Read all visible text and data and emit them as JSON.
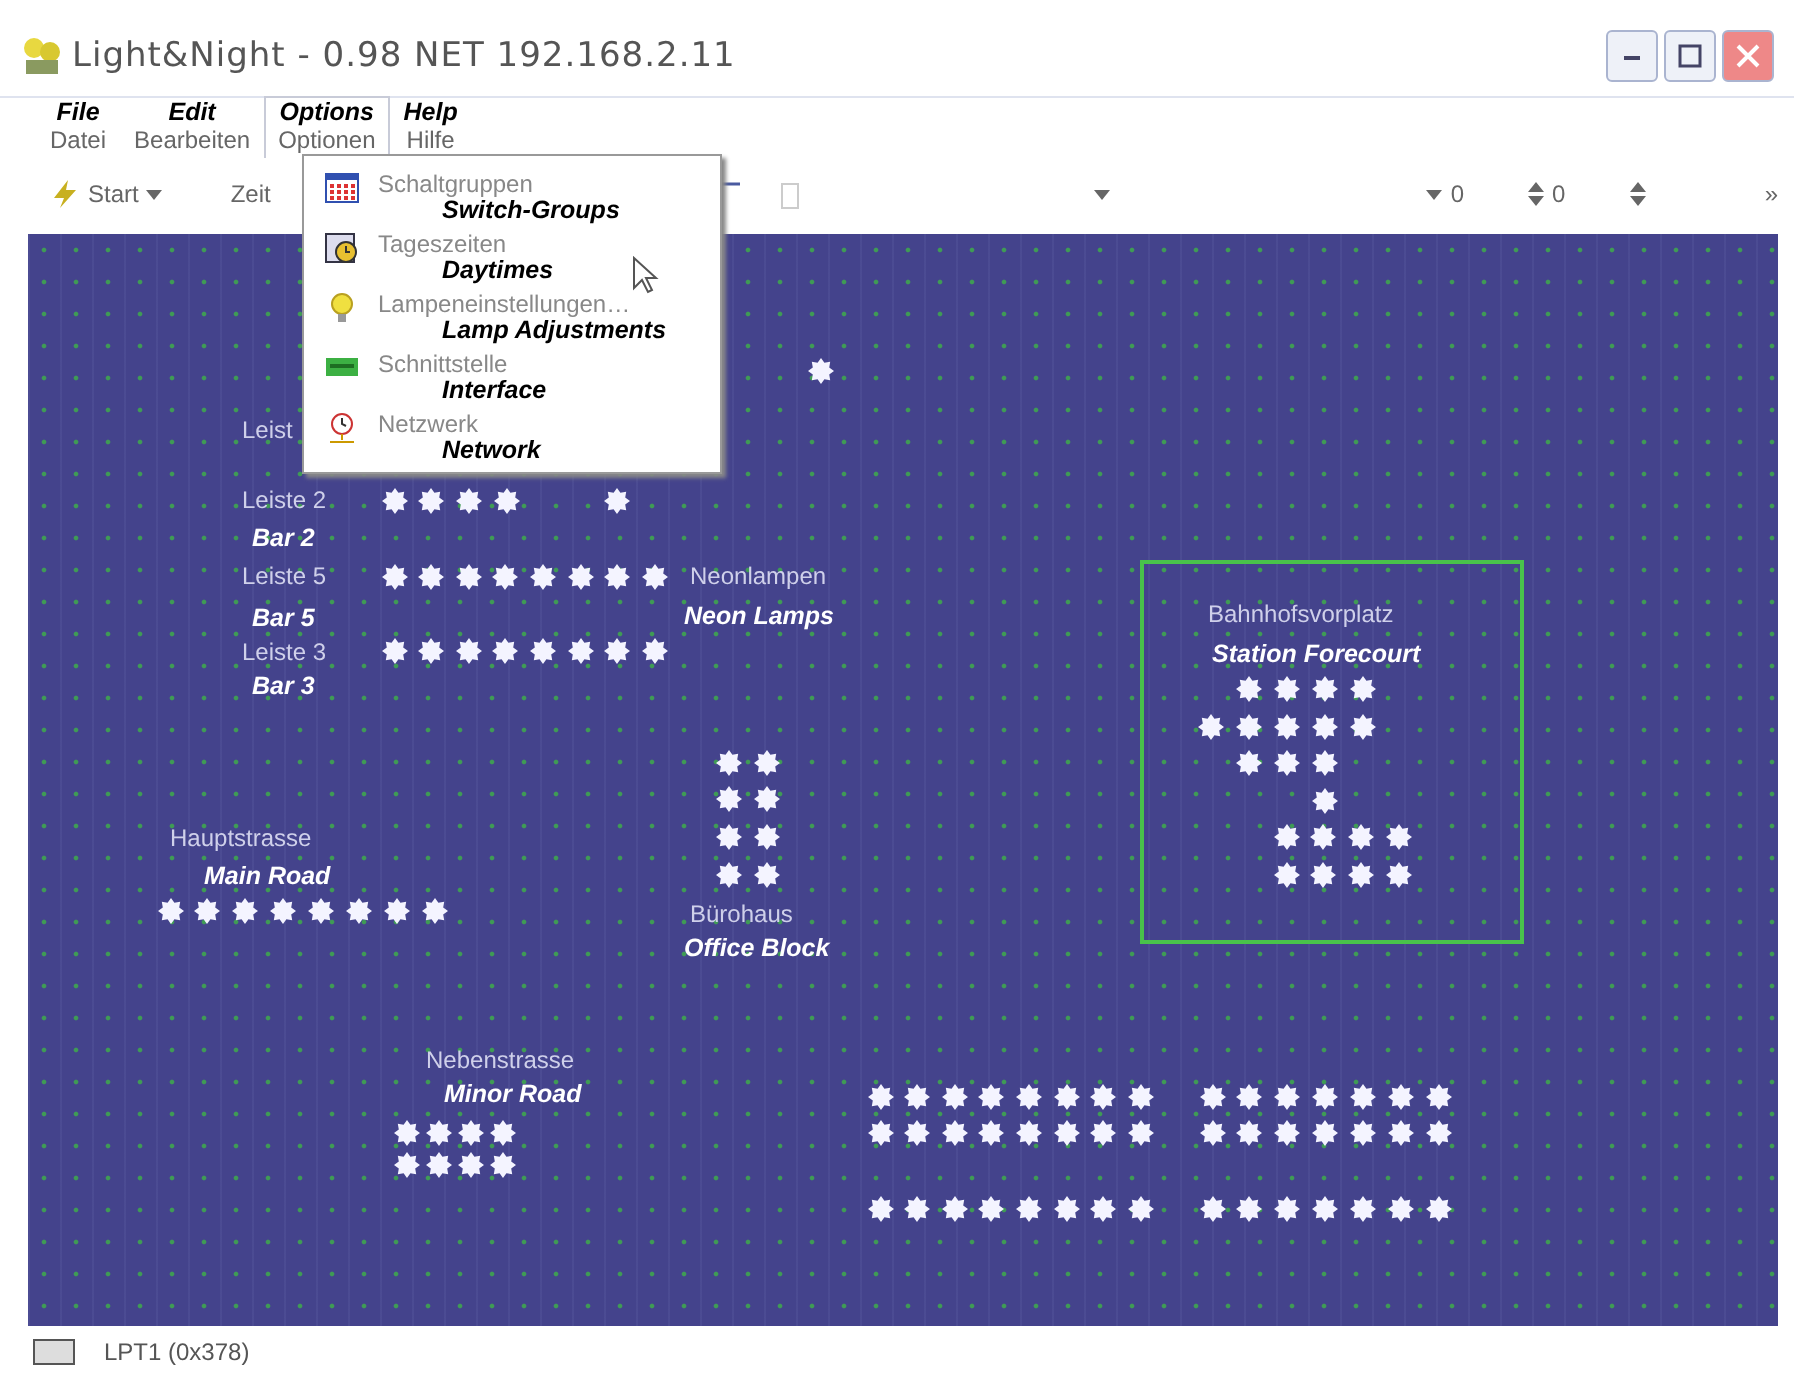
{
  "window": {
    "title": "Light&Night - 0.98 NET 192.168.2.11"
  },
  "menu_bar": [
    {
      "label": "Datei",
      "annotation": "File",
      "selected": false
    },
    {
      "label": "Bearbeiten",
      "annotation": "Edit",
      "selected": false
    },
    {
      "label": "Optionen",
      "annotation": "Options",
      "selected": true
    },
    {
      "label": "Hilfe",
      "annotation": "Help",
      "selected": false
    }
  ],
  "toolbar": {
    "start": "Start",
    "time": "Zeit",
    "value_1": "0",
    "value_2": "0",
    "overflow": "»"
  },
  "options_menu": [
    {
      "label": "Schaltgruppen",
      "annotation": "Switch-Groups"
    },
    {
      "label": "Tageszeiten",
      "annotation": "Daytimes"
    },
    {
      "label": "Lampeneinstellungen…",
      "annotation": "Lamp Adjustments"
    },
    {
      "label": "Schnittstelle",
      "annotation": "Interface"
    },
    {
      "label": "Netzwerk",
      "annotation": "Network"
    }
  ],
  "canvas": {
    "labels": [
      {
        "text": "Leist"
      },
      {
        "text": "Leiste 2",
        "annotation": "Bar 2"
      },
      {
        "text": "Leiste 5",
        "annotation": "Bar 5"
      },
      {
        "text": "Neonlampen",
        "annotation": "Neon Lamps"
      },
      {
        "text": "Leiste 3",
        "annotation": "Bar 3"
      },
      {
        "text": "Hauptstrasse",
        "annotation": "Main Road"
      },
      {
        "text": "Bürohaus",
        "annotation": "Office Block"
      },
      {
        "text": "Nebenstrasse",
        "annotation": "Minor Road"
      }
    ],
    "selection_frame": {
      "text": "Bahnhofsvorplatz",
      "annotation": "Station Forecourt"
    }
  },
  "status_bar": {
    "port": "LPT1 (0x378)"
  }
}
